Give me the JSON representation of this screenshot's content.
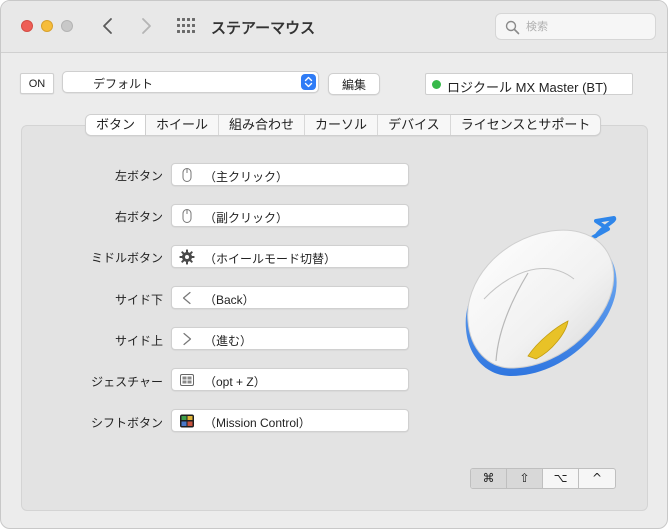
{
  "window": {
    "title": "ステアーマウス",
    "search_placeholder": "検索"
  },
  "toolbar": {
    "on_label": "ON",
    "preset_value": "デフォルト",
    "edit_label": "編集",
    "device_name": "ロジクール MX Master (BT)",
    "device_status_color": "#37b94a",
    "accent_color": "#2f7cf6"
  },
  "tabs": [
    {
      "label": "ボタン",
      "active": true
    },
    {
      "label": "ホイール",
      "active": false
    },
    {
      "label": "組み合わせ",
      "active": false
    },
    {
      "label": "カーソル",
      "active": false
    },
    {
      "label": "デバイス",
      "active": false
    },
    {
      "label": "ライセンスとサポート",
      "active": false
    }
  ],
  "buttons": [
    {
      "label": "左ボタン",
      "value": "（主クリック）",
      "icon": "mouse-icon"
    },
    {
      "label": "右ボタン",
      "value": "（副クリック）",
      "icon": "mouse-icon"
    },
    {
      "label": "ミドルボタン",
      "value": "（ホイールモード切替）",
      "icon": "gear-icon"
    },
    {
      "label": "サイド下",
      "value": "（Back）",
      "icon": "chevron-left-icon"
    },
    {
      "label": "サイド上",
      "value": "（進む）",
      "icon": "chevron-right-icon"
    },
    {
      "label": "ジェスチャー",
      "value": "（opt + Z）",
      "icon": "gesture-icon"
    },
    {
      "label": "シフトボタン",
      "value": "（Mission Control）",
      "icon": "mission-control-icon"
    }
  ],
  "modifier_keys": [
    {
      "symbol": "⌘",
      "name": "command-key",
      "pressed": true
    },
    {
      "symbol": "⇧",
      "name": "shift-key",
      "pressed": true
    },
    {
      "symbol": "⌥",
      "name": "option-key",
      "pressed": false
    },
    {
      "symbol": "^",
      "name": "control-key",
      "pressed": false
    }
  ]
}
